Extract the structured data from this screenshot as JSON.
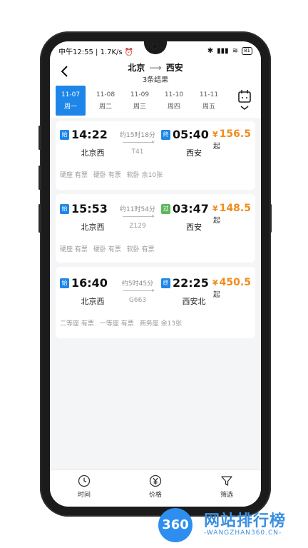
{
  "status_bar": {
    "time": "中午12:55",
    "speed": "1.7K/s",
    "battery": "81"
  },
  "header": {
    "from": "北京",
    "to": "西安",
    "result_count": "3条结果"
  },
  "dates": [
    {
      "date": "11-07",
      "weekday": "周一",
      "active": true
    },
    {
      "date": "11-08",
      "weekday": "周二",
      "active": false
    },
    {
      "date": "11-09",
      "weekday": "周三",
      "active": false
    },
    {
      "date": "11-10",
      "weekday": "周四",
      "active": false
    },
    {
      "date": "11-11",
      "weekday": "周五",
      "active": false
    }
  ],
  "trains": [
    {
      "start_tag": "始",
      "depart": "14:22",
      "duration": "约15时18分",
      "train_no": "T41",
      "end_tag": "终",
      "end_tag_color": "#1e86e8",
      "arrive": "05:40",
      "currency": "¥",
      "price": "156.5",
      "price_suffix": "起",
      "from_station": "北京西",
      "to_station": "西安",
      "seats": [
        "硬座 有票",
        "硬卧 有票",
        "软卧 余10张"
      ]
    },
    {
      "start_tag": "始",
      "depart": "15:53",
      "duration": "约11时54分",
      "train_no": "Z129",
      "end_tag": "过",
      "end_tag_color": "#5cb85c",
      "arrive": "03:47",
      "currency": "¥",
      "price": "148.5",
      "price_suffix": "起",
      "from_station": "北京西",
      "to_station": "西安",
      "seats": [
        "硬座 有票",
        "硬卧 有票",
        "软卧 有票"
      ]
    },
    {
      "start_tag": "始",
      "depart": "16:40",
      "duration": "约5时45分",
      "train_no": "G663",
      "end_tag": "终",
      "end_tag_color": "#1e86e8",
      "arrive": "22:25",
      "currency": "¥",
      "price": "450.5",
      "price_suffix": "起",
      "from_station": "北京西",
      "to_station": "西安北",
      "seats": [
        "二等座 有票",
        "一等座 有票",
        "商务座 余13张"
      ]
    }
  ],
  "bottom_tabs": [
    {
      "label": "时间",
      "icon": "clock-icon"
    },
    {
      "label": "价格",
      "icon": "yen-icon"
    },
    {
      "label": "筛选",
      "icon": "filter-icon"
    }
  ],
  "watermark": {
    "badge": "360",
    "title": "网站排行榜",
    "subtitle": "-WANGZHAN360.CN-"
  },
  "colors": {
    "accent": "#1e86e8",
    "price": "#f08c1e"
  }
}
